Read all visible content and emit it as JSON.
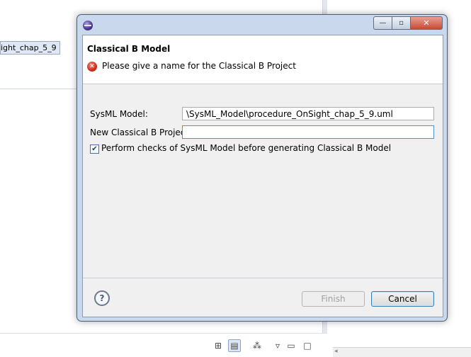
{
  "background": {
    "tree_item_label": "ight_chap_5_9"
  },
  "dialog": {
    "header_title": "Classical B Model",
    "error_message": "Please give a name for the Classical B Project",
    "fields": {
      "sysml_label": "SysML Model:",
      "sysml_value": "\\SysML_Model\\procedure_OnSight_chap_5_9.uml",
      "project_label": "New Classical B Project:",
      "project_value": ""
    },
    "checkbox": {
      "label": "Perform checks of SysML Model before generating Classical B Model",
      "checked": true,
      "glyph": "✔"
    },
    "buttons": {
      "finish_label": "Finish",
      "cancel_label": "Cancel",
      "help_glyph": "?"
    },
    "window_buttons": {
      "minimize": "—",
      "maximize": "▫",
      "close": "✕"
    }
  },
  "toolbar_icons": [
    "tree-icon",
    "outline-icon",
    "hierarchy-icon",
    "view-menu-icon",
    "minimize-icon",
    "maximize-icon"
  ],
  "colors": {
    "dialog_frame": "#c9d8ec",
    "error_red": "#d02a1c",
    "default_button_border": "#3c7fb1"
  }
}
